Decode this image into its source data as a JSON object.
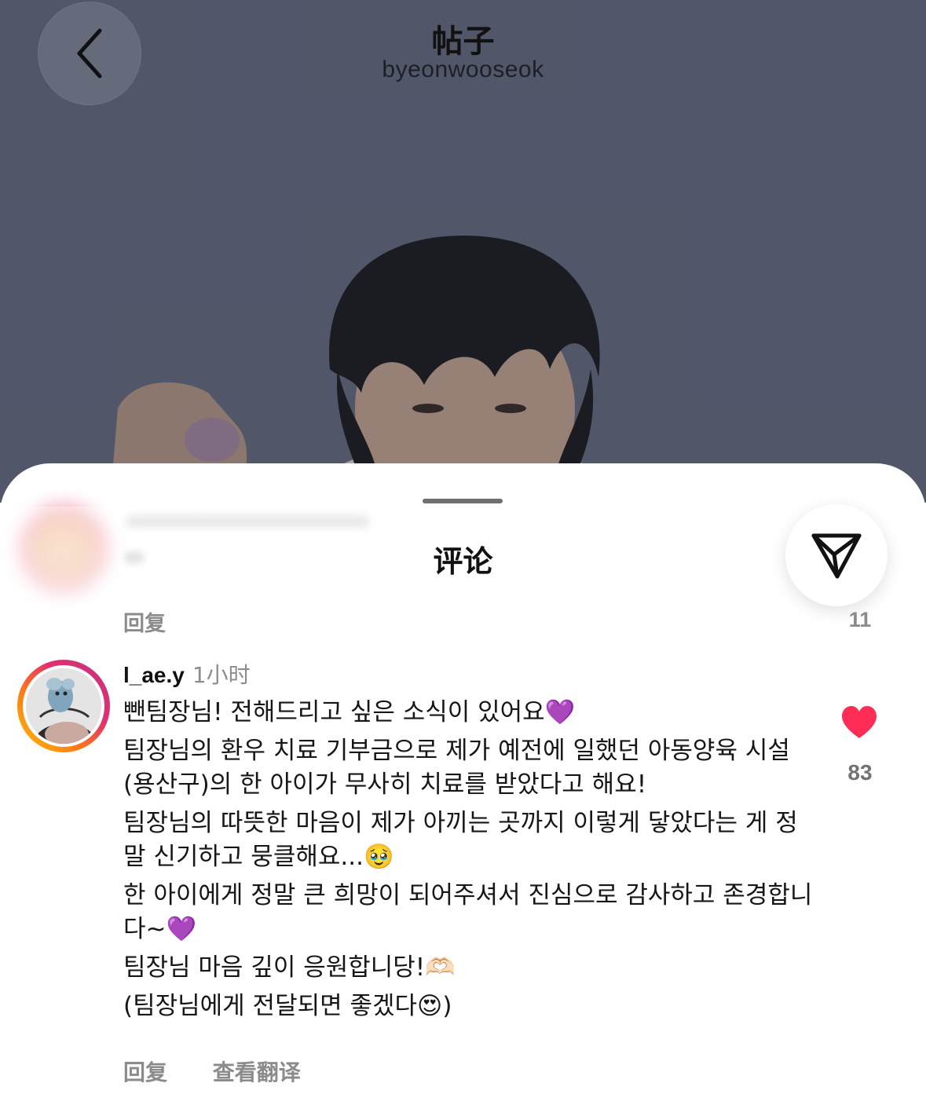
{
  "header": {
    "title": "帖子",
    "subtitle": "byeonwooseok"
  },
  "sheet": {
    "title": "评论"
  },
  "previous_comment": {
    "reply_label": "回复",
    "like_count": "11"
  },
  "comment": {
    "username": "l_ae.y",
    "time": "1小时",
    "lines": [
      "뺀팀장님! 전해드리고 싶은 소식이 있어요💜",
      "팀장님의 환우 치료 기부금으로 제가 예전에 일했던 아동양육 시설(용산구)의 한 아이가 무사히 치료를 받았다고 해요!",
      "팀장님의 따뜻한 마음이 제가 아끼는 곳까지 이렇게 닿았다는 게 정말 신기하고 뭉클해요...🥹",
      "한 아이에게 정말 큰 희망이 되어주셔서 진심으로 감사하고 존경합니다~💜",
      "팀장님 마음 깊이 응원합니당!🫶🏻",
      "(팀장님에게 전달되면 좋겠다😍)"
    ],
    "like_count": "83",
    "reply_label": "回复",
    "translate_label": "查看翻译"
  },
  "icons": {
    "back": "chevron-left-icon",
    "share": "send-icon",
    "like": "heart-icon"
  },
  "colors": {
    "like": "#ff2d55",
    "muted_text": "#8b8b8b",
    "story_ring_start": "#ffc107",
    "story_ring_end": "#c13584"
  }
}
